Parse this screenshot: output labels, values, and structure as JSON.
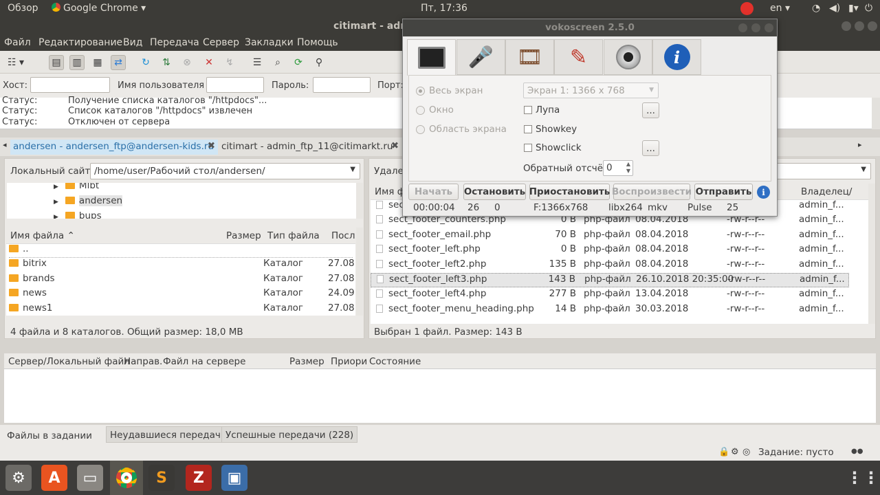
{
  "topbar": {
    "overview": "Обзор",
    "app_name": "Google Chrome",
    "clock": "Пт, 17:36",
    "lang": "en"
  },
  "window": {
    "title": "citimart - admi"
  },
  "menu": [
    "Файл",
    "Редактирование",
    "Вид",
    "Передача",
    "Сервер",
    "Закладки",
    "Помощь"
  ],
  "quickconnect": {
    "host_label": "Хост:",
    "user_label": "Имя пользователя",
    "pass_label": "Пароль:",
    "port_label": "Порт:",
    "host_value": "",
    "user_value": "",
    "pass_value": ""
  },
  "log": [
    {
      "key": "Статус:",
      "msg": "Получение списка каталогов \"/httpdocs\"..."
    },
    {
      "key": "Статус:",
      "msg": "Список каталогов \"/httpdocs\" извлечен"
    },
    {
      "key": "Статус:",
      "msg": "Отключен от сервера"
    }
  ],
  "tabs": [
    {
      "label": "andersen - andersen_ftp@andersen-kids.ru"
    },
    {
      "label": "citimart - admin_ftp_11@citimarkt.ru"
    }
  ],
  "local": {
    "site_label": "Локальный сайт:",
    "path": "/home/user/Рабочий стол/andersen/",
    "tree": [
      "Mlbt",
      "andersen",
      "bups"
    ],
    "headers": {
      "name": "Имя файла",
      "size": "Размер",
      "type": "Тип файла",
      "last": "Посл"
    },
    "rows": [
      {
        "name": "..",
        "size": "",
        "type": "",
        "date": ""
      },
      {
        "name": "bitrix",
        "size": "",
        "type": "Каталог",
        "date": "27.08."
      },
      {
        "name": "brands",
        "size": "",
        "type": "Каталог",
        "date": "27.08."
      },
      {
        "name": "news",
        "size": "",
        "type": "Каталог",
        "date": "24.09."
      },
      {
        "name": "news1",
        "size": "",
        "type": "Каталог",
        "date": "27.08."
      }
    ],
    "status": "4 файла и 8 каталогов. Общий размер: 18,0 MB"
  },
  "remote": {
    "site_label": "Удален",
    "headers": {
      "name": "Имя ф",
      "owner": "Владелец/"
    },
    "rows": [
      {
        "name": "sect",
        "size": "",
        "type": "",
        "date": "",
        "perm": "",
        "owner": "admin_f..."
      },
      {
        "name": "sect_footer_counters.php",
        "size": "0 B",
        "type": "php-файл",
        "date": "08.04.2018",
        "perm": "-rw-r--r--",
        "owner": "admin_f..."
      },
      {
        "name": "sect_footer_email.php",
        "size": "70 B",
        "type": "php-файл",
        "date": "08.04.2018",
        "perm": "-rw-r--r--",
        "owner": "admin_f..."
      },
      {
        "name": "sect_footer_left.php",
        "size": "0 B",
        "type": "php-файл",
        "date": "08.04.2018",
        "perm": "-rw-r--r--",
        "owner": "admin_f..."
      },
      {
        "name": "sect_footer_left2.php",
        "size": "135 B",
        "type": "php-файл",
        "date": "08.04.2018",
        "perm": "-rw-r--r--",
        "owner": "admin_f..."
      },
      {
        "name": "sect_footer_left3.php",
        "size": "143 B",
        "type": "php-файл",
        "date": "26.10.2018 20:35:00",
        "perm": "-rw-r--r--",
        "owner": "admin_f..."
      },
      {
        "name": "sect_footer_left4.php",
        "size": "277 B",
        "type": "php-файл",
        "date": "13.04.2018",
        "perm": "-rw-r--r--",
        "owner": "admin_f..."
      },
      {
        "name": "sect_footer_menu_heading.php",
        "size": "14 B",
        "type": "php-файл",
        "date": "30.03.2018",
        "perm": "-rw-r--r--",
        "owner": "admin_f..."
      }
    ],
    "status": "Выбран 1 файл. Размер: 143 B"
  },
  "queue": {
    "headers": [
      "Сервер/Локальный файл",
      "Направ.",
      "Файл на сервере",
      "Размер",
      "Приори",
      "Состояние"
    ]
  },
  "bottom_tabs": [
    "Файлы в задании",
    "Неудавшиеся передачи",
    "Успешные передачи (228)"
  ],
  "statusbar": {
    "queue": "Задание: пусто"
  },
  "vokoscreen": {
    "title": "vokoscreen 2.5.0",
    "full_screen": "Весь экран",
    "window": "Окно",
    "area": "Область экрана",
    "screen_select": "Экран 1:  1366 x 768",
    "magnifier": "Лупа",
    "showkey": "Showkey",
    "showclick": "Showclick",
    "countdown_label": "Обратный отсчёт",
    "countdown_value": "0",
    "dots": "...",
    "buttons": {
      "start": "Начать",
      "stop": "Остановить",
      "pause": "Приостановить",
      "play": "Воспроизвести",
      "send": "Отправить"
    },
    "info": {
      "time": "00:00:04",
      "fps": "26",
      "frames": "0",
      "format": "F:1366x768",
      "codec": "libx264",
      "container": "mkv",
      "audio": "Pulse",
      "quality": "25"
    }
  }
}
